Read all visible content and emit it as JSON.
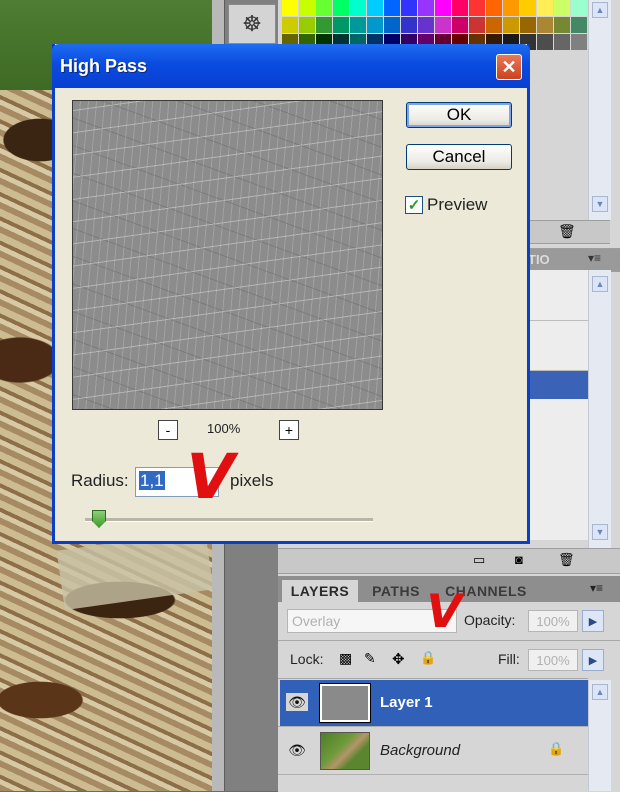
{
  "dialog": {
    "title": "High Pass",
    "ok_label": "OK",
    "cancel_label": "Cancel",
    "preview_label": "Preview",
    "preview_checked": true,
    "zoom_out_label": "-",
    "zoom_in_label": "+",
    "zoom_level": "100%",
    "radius_label": "Radius:",
    "radius_value": "1,1",
    "radius_unit": "pixels",
    "close_glyph": "✕"
  },
  "layers_panel": {
    "tabs": [
      "LAYERS",
      "PATHS",
      "CHANNELS"
    ],
    "active_tab": "LAYERS",
    "blend_mode": "Overlay",
    "opacity_label": "Opacity:",
    "opacity_value": "100%",
    "lock_label": "Lock:",
    "fill_label": "Fill:",
    "fill_value": "100%",
    "layers": [
      {
        "name": "Layer 1",
        "selected": true,
        "visible": true
      },
      {
        "name": "Background",
        "selected": false,
        "visible": true,
        "locked": true
      }
    ]
  },
  "mid_panel": {
    "tab_fragment": "TIO"
  },
  "annotations": {
    "check_mark": "V"
  },
  "colors": {
    "xp_title": "#0a4be0",
    "selection": "#3a63b7",
    "annotation_red": "#e01010"
  },
  "swatches": [
    "#ffff00",
    "#c8ff00",
    "#66ff33",
    "#00ff66",
    "#00ffcc",
    "#00ccff",
    "#0066ff",
    "#3333ff",
    "#9933ff",
    "#ff00ff",
    "#ff0066",
    "#ff3333",
    "#ff6600",
    "#ff9900",
    "#ffcc00",
    "#ffee55",
    "#ccff66",
    "#99ffcc",
    "#66ccff",
    "#cccc00",
    "#99cc00",
    "#339933",
    "#009966",
    "#009999",
    "#0099cc",
    "#0066cc",
    "#3333cc",
    "#6633cc",
    "#cc33cc",
    "#cc0066",
    "#cc3333",
    "#cc6600",
    "#cc9900",
    "#996600",
    "#aa8833",
    "#778833",
    "#448866",
    "#336699",
    "#666600",
    "#336600",
    "#003300",
    "#003333",
    "#006666",
    "#003366",
    "#000066",
    "#330066",
    "#660066",
    "#660033",
    "#660000",
    "#663300",
    "#331a00",
    "#1a1a1a",
    "#333333",
    "#4d4d4d",
    "#666666",
    "#808080",
    "#999999"
  ]
}
